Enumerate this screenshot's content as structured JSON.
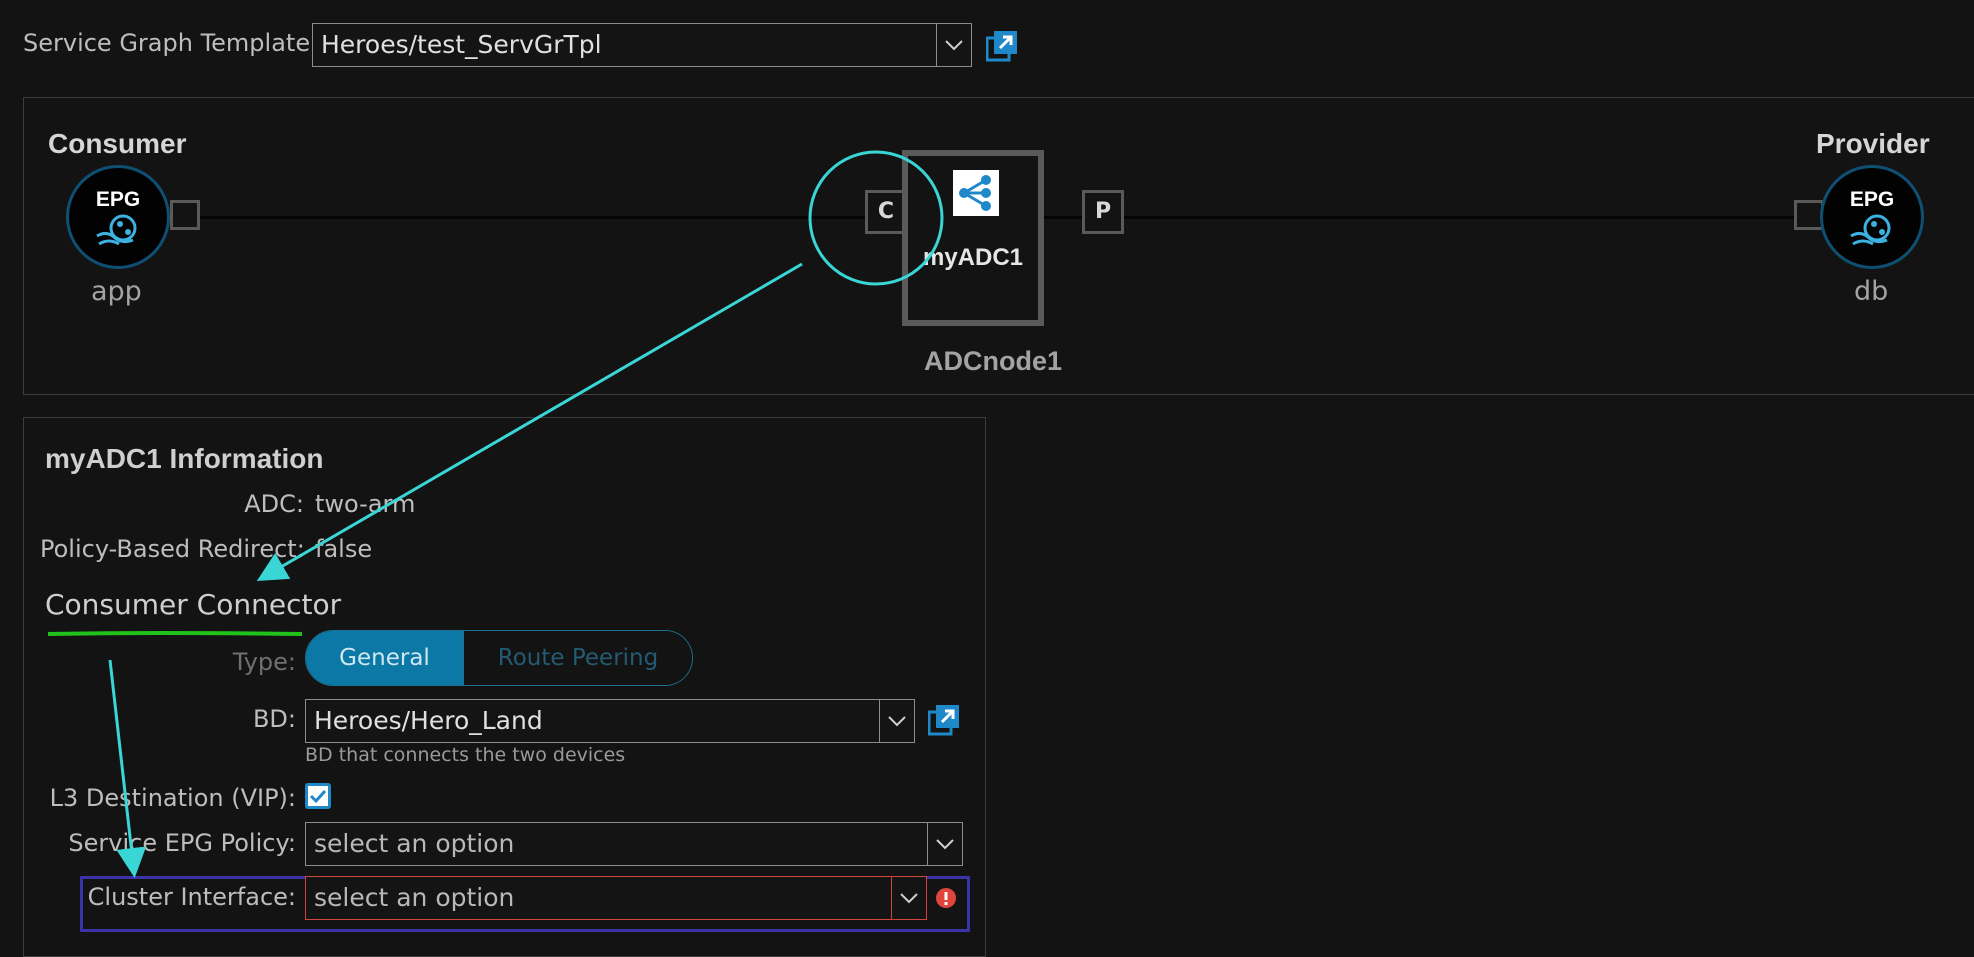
{
  "header": {
    "sgt_label": "Service Graph Template:",
    "sgt_value": "Heroes/test_ServGrTpl"
  },
  "graph": {
    "consumer_title": "Consumer",
    "consumer_epg": "EPG",
    "consumer_name": "app",
    "provider_title": "Provider",
    "provider_epg": "EPG",
    "provider_name": "db",
    "connector_c": "C",
    "connector_p": "P",
    "device_name": "myADC1",
    "node_name": "ADCnode1",
    "device_icon": "share-network-icon"
  },
  "info": {
    "title": "myADC1 Information",
    "adc_label": "ADC:",
    "adc_value": "two-arm",
    "pbr_label": "Policy-Based Redirect:",
    "pbr_value": "false"
  },
  "connector": {
    "title": "Consumer Connector",
    "type_label": "Type:",
    "type_options": [
      "General",
      "Route Peering"
    ],
    "type_selected": "General",
    "bd_label": "BD:",
    "bd_value": "Heroes/Hero_Land",
    "bd_hint": "BD that connects the two devices",
    "l3_label": "L3 Destination (VIP):",
    "l3_checked": true,
    "sepg_label": "Service EPG Policy:",
    "sepg_placeholder": "select an option",
    "cluster_label": "Cluster Interface:",
    "cluster_placeholder": "select an option",
    "cluster_error_icon": "error-icon"
  },
  "colors": {
    "accent": "#0b78a6",
    "annotation_cyan": "#3ad6d6",
    "annotation_green": "#22c21c",
    "annotation_blue": "#3a32a8",
    "error_red": "#e0443c"
  }
}
